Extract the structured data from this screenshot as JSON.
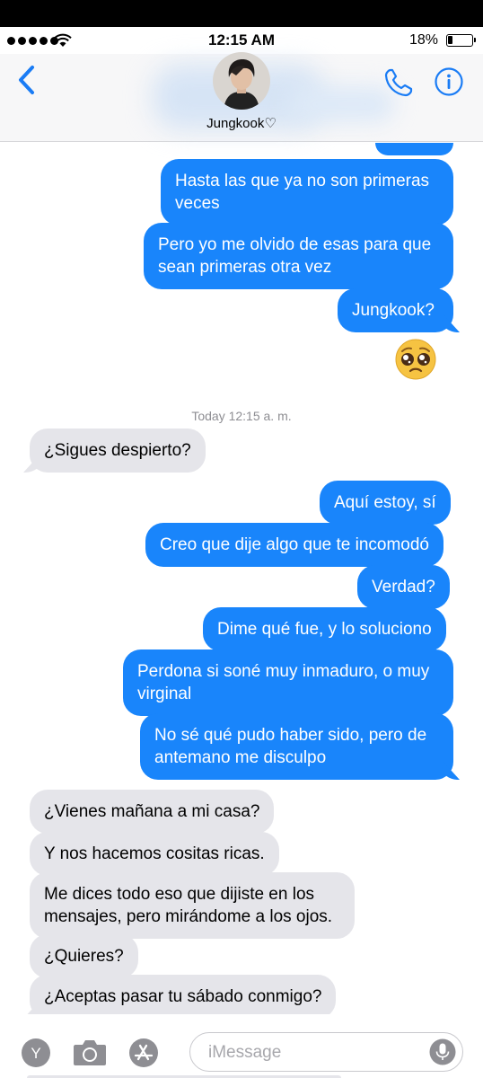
{
  "status_bar": {
    "time": "12:15 AM",
    "battery_pct": "18%",
    "battery_level": 0.18,
    "signal_bars": 5
  },
  "header": {
    "contact_name": "Jungkook♡",
    "back_icon": "chevron-left-icon",
    "call_icon": "phone-icon",
    "info_icon": "info-icon"
  },
  "messages": [
    {
      "dir": "out",
      "text": "Hasta las que ya no son primeras veces"
    },
    {
      "dir": "out",
      "text": "Pero yo me olvido de esas para que sean primeras otra vez"
    },
    {
      "dir": "out",
      "text": "Jungkook?"
    },
    {
      "dir": "out",
      "emoji": "pleading-face"
    },
    {
      "dir": "in",
      "text": "¿Sigues despierto?"
    },
    {
      "dir": "out",
      "text": "Aquí estoy, sí"
    },
    {
      "dir": "out",
      "text": "Creo que dije algo que te incomodó"
    },
    {
      "dir": "out",
      "text": "Verdad?"
    },
    {
      "dir": "out",
      "text": "Dime qué fue, y lo soluciono"
    },
    {
      "dir": "out",
      "text": "Perdona si soné muy inmaduro, o muy virginal"
    },
    {
      "dir": "out",
      "text": "No sé qué pudo haber sido, pero de antemano me disculpo"
    },
    {
      "dir": "in",
      "text": "¿Vienes mañana a mi casa?"
    },
    {
      "dir": "in",
      "text": "Y nos hacemos cositas ricas."
    },
    {
      "dir": "in",
      "text": "Me dices todo eso que dijiste en los mensajes, pero mirándome a los ojos."
    },
    {
      "dir": "in",
      "text": "¿Quieres?"
    },
    {
      "dir": "in",
      "text": "¿Aceptas pasar tu sábado conmigo?"
    }
  ],
  "timestamp": "Today 12:15 a. m.",
  "input": {
    "placeholder": "iMessage",
    "app_y_label": "Y",
    "camera_icon": "camera-icon",
    "appstore_icon": "app-store-icon",
    "mic_icon": "microphone-icon"
  },
  "colors": {
    "outgoing": "#1985fb",
    "incoming": "#e5e5ea",
    "accent": "#1a7cf5"
  }
}
